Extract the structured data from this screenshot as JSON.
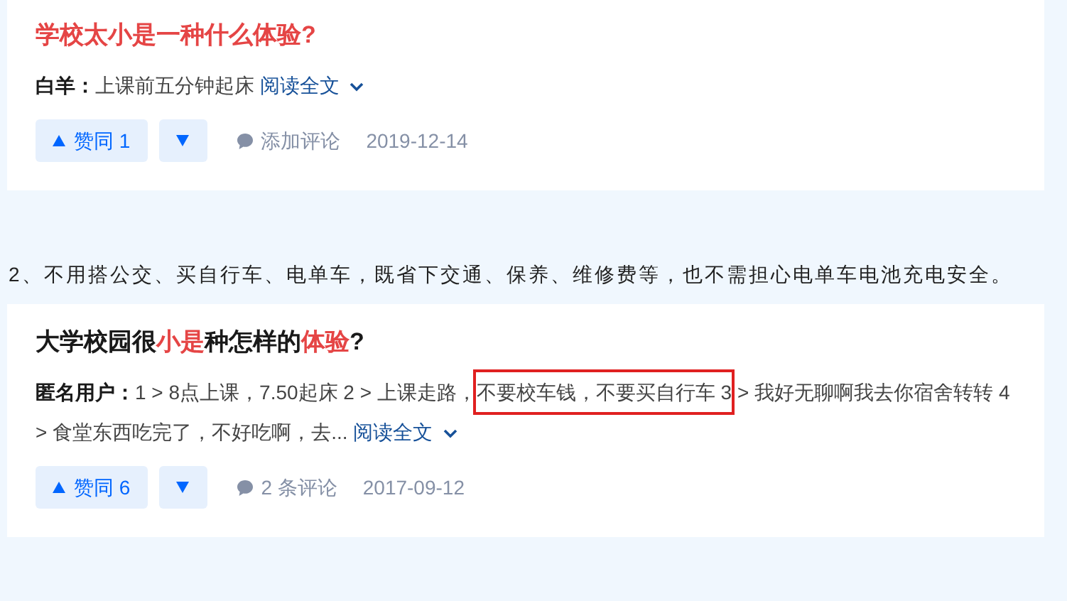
{
  "answers": [
    {
      "title_parts": [
        {
          "text": "学校太小是一种什么体验?",
          "highlight": true
        }
      ],
      "author": "白羊：",
      "excerpt": [
        {
          "text": "上课前五分钟起床",
          "boxed": false
        }
      ],
      "read_more": "阅读全文",
      "upvote": "赞同 1",
      "comments": "添加评论",
      "date": "2019-12-14"
    },
    {
      "title_parts": [
        {
          "text": "大学校园很",
          "highlight": false
        },
        {
          "text": "小是",
          "highlight": true
        },
        {
          "text": "种怎样的",
          "highlight": false
        },
        {
          "text": "体验",
          "highlight": true
        },
        {
          "text": "?",
          "highlight": false
        }
      ],
      "author": "匿名用户：",
      "excerpt": [
        {
          "text": "1 > 8点上课，7.50起床 2 > 上课走路，",
          "boxed": false
        },
        {
          "text": "不要校车钱，不要买自行车 3",
          "boxed": true
        },
        {
          "text": " > 我好无聊啊我去你宿舍转转 4 > 食堂东西吃完了，不好吃啊，去...",
          "boxed": false
        }
      ],
      "read_more": "阅读全文",
      "upvote": "赞同 6",
      "comments": "2 条评论",
      "date": "2017-09-12"
    }
  ],
  "paragraph": "2、不用搭公交、买自行车、电单车，既省下交通、保养、维修费等，也不需担心电单车电池充电安全。"
}
